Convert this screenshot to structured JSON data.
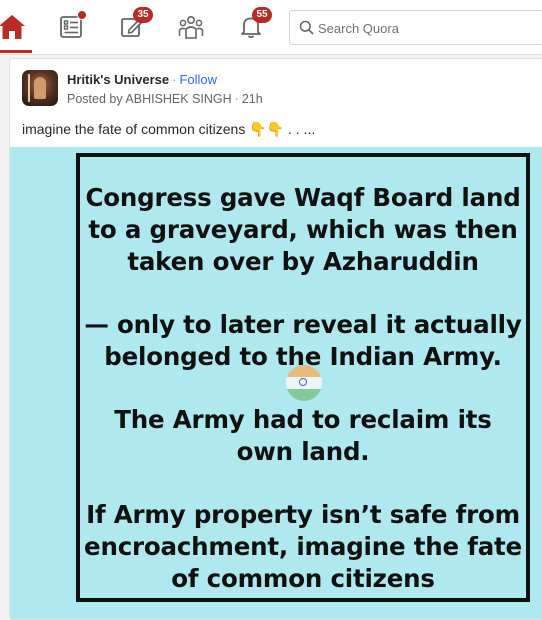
{
  "nav": {
    "items": [
      {
        "name": "home",
        "icon": "home-icon",
        "active": true
      },
      {
        "name": "following",
        "icon": "following-feed-icon",
        "dot": true
      },
      {
        "name": "answer",
        "icon": "answer-pencil-icon",
        "badge": "35"
      },
      {
        "name": "spaces",
        "icon": "spaces-people-icon"
      },
      {
        "name": "notifications",
        "icon": "bell-icon",
        "badge": "55"
      }
    ],
    "search": {
      "placeholder": "Search Quora",
      "value": ""
    },
    "accent_color": "#b92b27"
  },
  "post": {
    "author": "Hritik's Universe",
    "follow_label": "Follow",
    "posted_by_label": "Posted by",
    "poster_name": "ABHISHEK SINGH",
    "time": "21h",
    "text": "imagine the fate of common citizens",
    "text_emoji": "👇👇",
    "text_trail": ". . ...",
    "image": {
      "background_color": "#afe8ee",
      "lines": [
        "Congress gave Waqf Board land",
        "to a graveyard, which was then",
        "taken over by Azharuddin",
        "— only to later reveal it actually",
        "belonged to the Indian Army.",
        "The Army had to reclaim its",
        "own land.",
        "If Army property isn’t safe from",
        "encroachment, imagine the fate",
        "of common citizens"
      ],
      "emoji": "indian-flag-icon"
    }
  }
}
